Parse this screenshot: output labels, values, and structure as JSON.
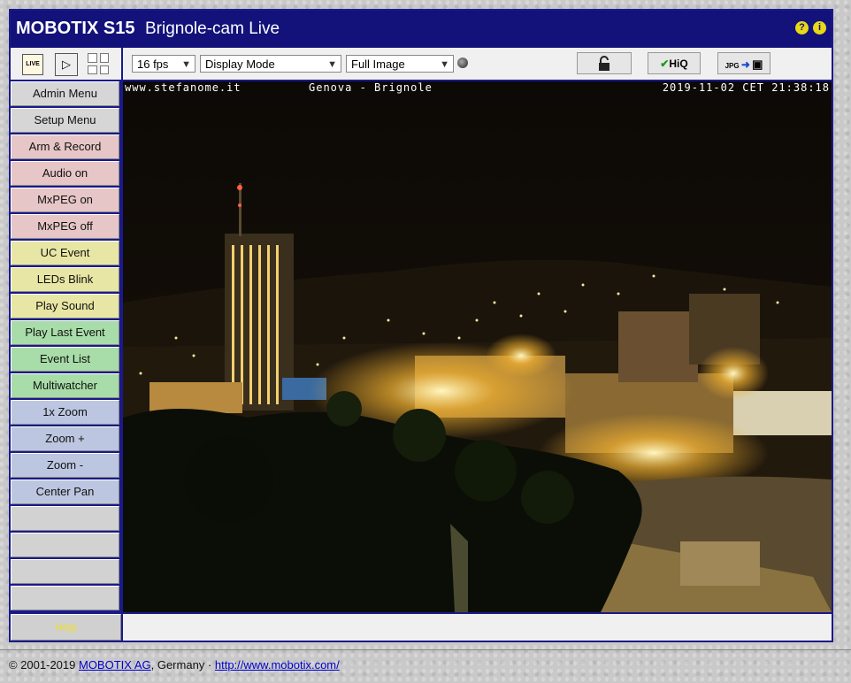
{
  "header": {
    "brand": "MOBOTIX S15",
    "camera_name": "Brignole-cam Live",
    "help_icon": "?",
    "info_icon": "i"
  },
  "toolbar": {
    "live_label": "LIVE",
    "fps": "16 fps",
    "display_mode": "Display Mode",
    "image_mode": "Full Image",
    "hiq_label": "HiQ",
    "jpg_label": "JPG"
  },
  "sidebar": {
    "items": [
      {
        "label": "Admin Menu",
        "color": "gray"
      },
      {
        "label": "Setup Menu",
        "color": "gray"
      },
      {
        "label": "Arm & Record",
        "color": "pink"
      },
      {
        "label": "Audio on",
        "color": "pink"
      },
      {
        "label": "MxPEG on",
        "color": "pink"
      },
      {
        "label": "MxPEG off",
        "color": "pink"
      },
      {
        "label": "UC Event",
        "color": "yellow"
      },
      {
        "label": "LEDs Blink",
        "color": "yellow"
      },
      {
        "label": "Play Sound",
        "color": "yellow"
      },
      {
        "label": "Play Last Event",
        "color": "green"
      },
      {
        "label": "Event List",
        "color": "green"
      },
      {
        "label": "Multiwatcher",
        "color": "green"
      },
      {
        "label": "1x Zoom",
        "color": "blue"
      },
      {
        "label": "Zoom +",
        "color": "blue"
      },
      {
        "label": "Zoom -",
        "color": "blue"
      },
      {
        "label": "Center Pan",
        "color": "blue"
      }
    ],
    "empty_slots": 4,
    "help_label": "Help"
  },
  "video": {
    "overlay_left": "www.stefanome.it",
    "overlay_center": "Genova - Brignole",
    "overlay_right": "2019-11-02 CET 21:38:18"
  },
  "footer": {
    "copyright": "© 2001-2019 ",
    "company_link": "MOBOTIX AG",
    "country": ", Germany · ",
    "url_link": "http://www.mobotix.com/"
  },
  "colors": {
    "frame": "#1a1a8a",
    "titlebar": "#12127a"
  }
}
